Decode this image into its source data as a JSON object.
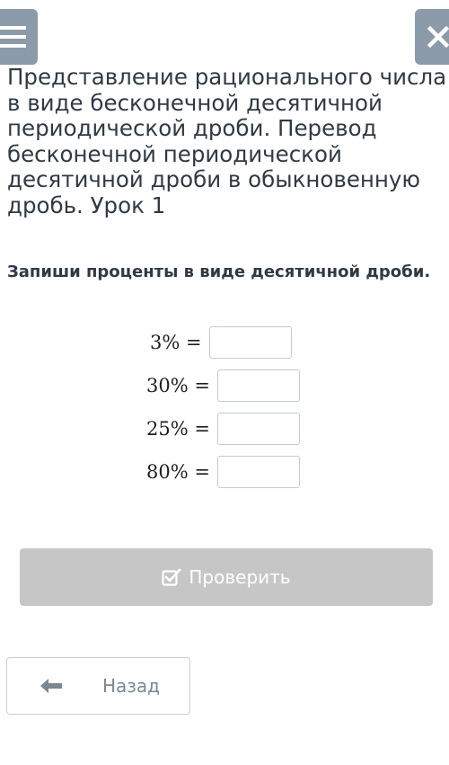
{
  "header": {
    "menu_icon": "hamburger-menu-icon",
    "close_icon": "close-icon",
    "lesson_title": "Представление рационального числа в виде бесконечной десятичной периодической дроби. Перевод бесконечной периодической десятичной дроби в обыкновенную дробь. Урок 1"
  },
  "task": {
    "title": "Запиши проценты в виде десятичной дроби.",
    "rows": [
      {
        "label": "3% =",
        "value": ""
      },
      {
        "label": "30% =",
        "value": ""
      },
      {
        "label": "25% =",
        "value": ""
      },
      {
        "label": "80% =",
        "value": ""
      }
    ]
  },
  "actions": {
    "check_label": "Проверить",
    "check_icon": "checkbox-check-icon",
    "back_label": "Назад",
    "back_icon": "arrow-left-icon"
  },
  "colors": {
    "header_button_bg": "#8c9baa",
    "check_button_bg": "#c6c6c6",
    "text": "#2f3a45",
    "back_text": "#7a8894"
  }
}
